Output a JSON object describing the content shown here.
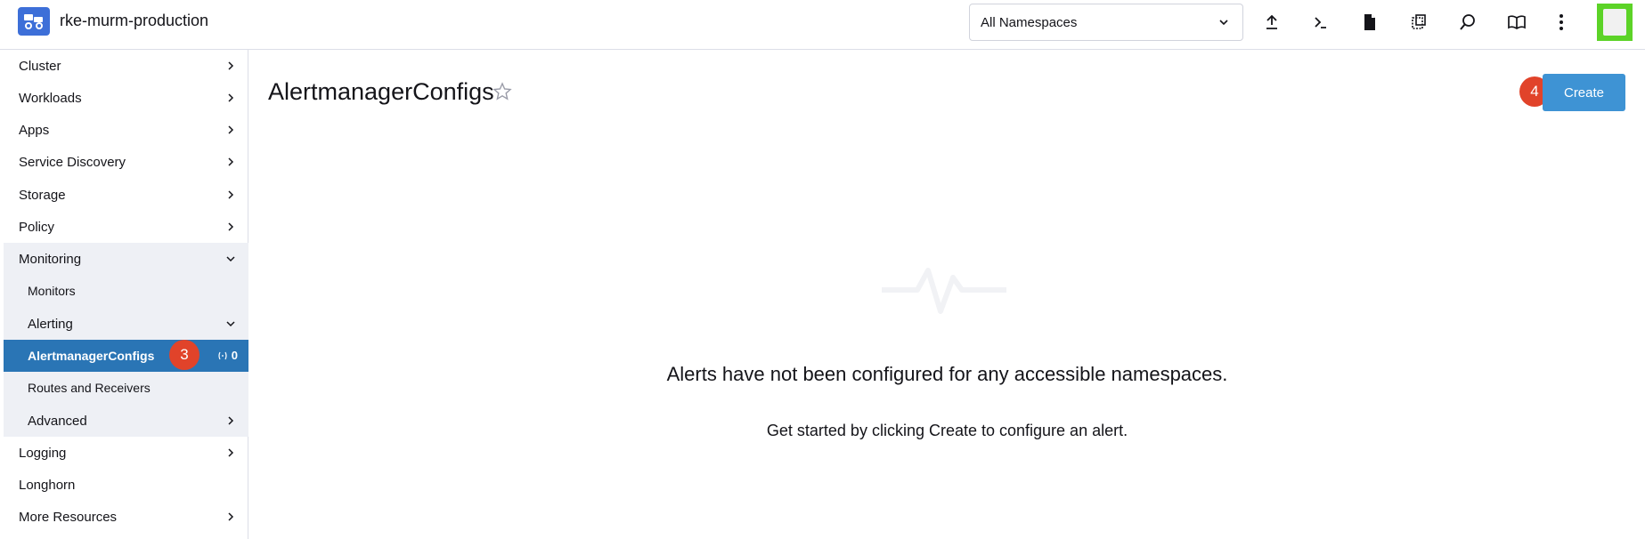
{
  "header": {
    "cluster_name": "rke-murm-production",
    "namespace_selected": "All Namespaces",
    "icons": [
      "upload-icon",
      "terminal-icon",
      "file-icon",
      "copy-config-icon",
      "search-icon",
      "book-icon",
      "kebab-menu-icon"
    ]
  },
  "sidebar": {
    "items": [
      {
        "label": "Cluster"
      },
      {
        "label": "Workloads"
      },
      {
        "label": "Apps"
      },
      {
        "label": "Service Discovery"
      },
      {
        "label": "Storage"
      },
      {
        "label": "Policy"
      },
      {
        "label": "Monitoring"
      },
      {
        "label": "Monitors"
      },
      {
        "label": "Alerting"
      },
      {
        "label": "AlertmanagerConfigs",
        "count": "0"
      },
      {
        "label": "Routes and Receivers"
      },
      {
        "label": "Advanced"
      },
      {
        "label": "Logging"
      },
      {
        "label": "Longhorn"
      },
      {
        "label": "More Resources"
      }
    ]
  },
  "markers": {
    "sidebar_step": "3",
    "create_step": "4"
  },
  "main": {
    "title": "AlertmanagerConfigs",
    "create_label": "Create",
    "empty_title": "Alerts have not been configured for any accessible namespaces.",
    "empty_subtitle": "Get started by clicking Create to configure an alert."
  },
  "colors": {
    "active": "#2a75b5",
    "primary": "#3e93d4",
    "marker": "#e1432a",
    "avatar": "#5cd327"
  }
}
